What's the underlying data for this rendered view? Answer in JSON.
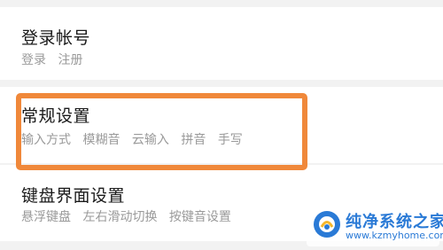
{
  "sections": [
    {
      "title": "登录帐号",
      "items": [
        "登录",
        "注册"
      ]
    },
    {
      "title": "常规设置",
      "items": [
        "输入方式",
        "模糊音",
        "云输入",
        "拼音",
        "手写"
      ]
    },
    {
      "title": "键盘界面设置",
      "items": [
        "悬浮键盘",
        "左右滑动切换",
        "按键音设置"
      ]
    }
  ],
  "watermark": {
    "name": "纯净系统之家",
    "url": "www.kzmyhome.com"
  },
  "colors": {
    "highlight": "#f0883a",
    "logo": "#2a7ad6",
    "title": "#1a1a1a",
    "subtitle": "#9a9a9a"
  }
}
